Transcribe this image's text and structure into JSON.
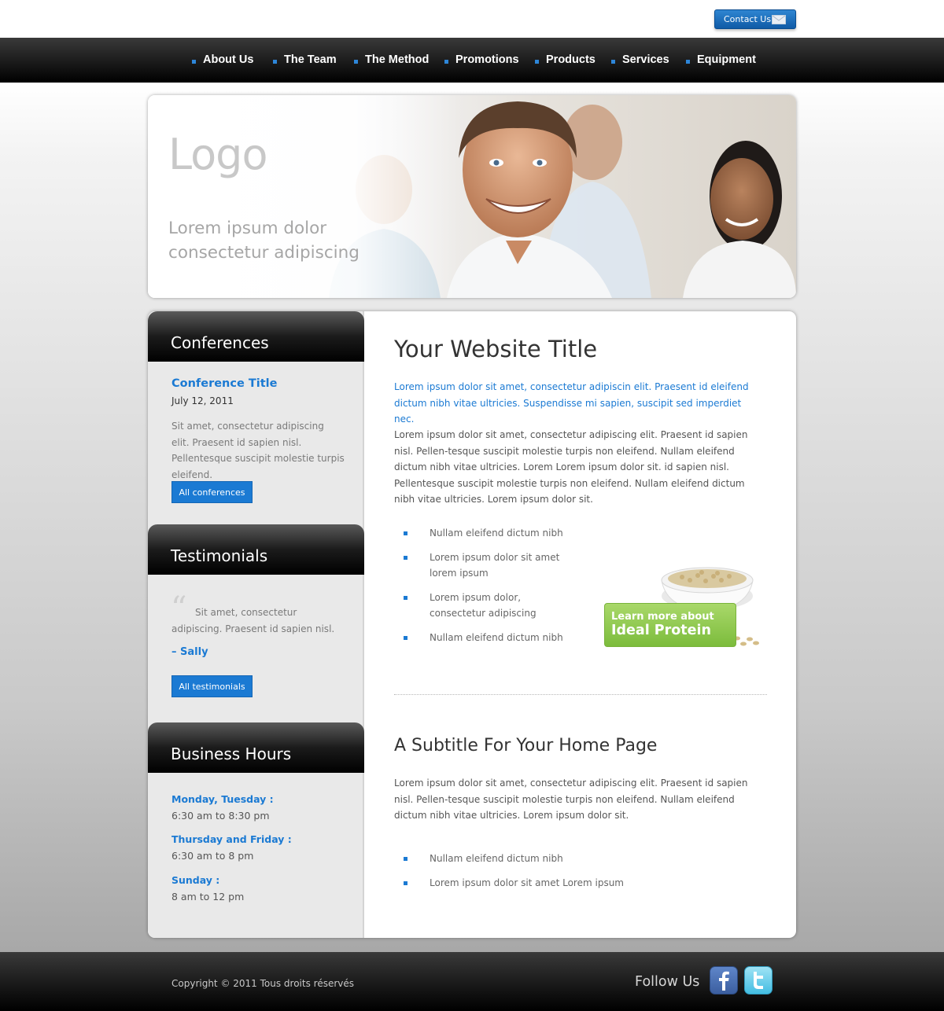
{
  "header": {
    "contact_label": "Contact Us"
  },
  "nav": {
    "items": [
      "About Us",
      "The Team",
      "The Method",
      "Promotions",
      "Products",
      "Services",
      "Equipment"
    ]
  },
  "hero": {
    "logo_text": "Logo",
    "tagline": "Lorem ipsum dolor consectetur adipiscing"
  },
  "sidebar": {
    "conferences": {
      "heading": "Conferences",
      "title": "Conference Title",
      "date": "July 12, 2011",
      "text": "Sit amet, consectetur adipiscing elit. Praesent id sapien nisl. Pellentesque suscipit molestie turpis eleifend.",
      "button": "All conferences"
    },
    "testimonials": {
      "heading": "Testimonials",
      "quote": "Sit amet, consectetur adipiscing. Praesent id sapien nisl.",
      "author": "– Sally",
      "button": "All testimonials"
    },
    "hours": {
      "heading": "Business Hours",
      "rows": [
        {
          "day": "Monday, Tuesday :",
          "time": "6:30 am to 8:30 pm"
        },
        {
          "day": "Thursday and Friday :",
          "time": "6:30 am to 8 pm"
        },
        {
          "day": "Sunday :",
          "time": "8 am to 12 pm"
        }
      ]
    }
  },
  "main": {
    "title": "Your Website Title",
    "intro": "Lorem ipsum dolor sit amet, consectetur adipiscin elit. Praesent id eleifend dictum nibh vitae ultricies. Suspendisse mi sapien, suscipit sed imperdiet nec.",
    "paragraph1": "Lorem ipsum dolor sit amet, consectetur adipiscing elit. Praesent id sapien nisl. Pellen-tesque suscipit molestie turpis non eleifend. Nullam eleifend dictum nibh vitae ultricies. Lorem Lorem ipsum dolor sit. id sapien nisl. Pellentesque suscipit molestie turpis non eleifend. Nullam eleifend dictum nibh vitae ultricies. Lorem ipsum dolor sit.",
    "list1": [
      "Nullam eleifend dictum nibh",
      "Lorem ipsum dolor sit amet lorem ipsum",
      "Lorem ipsum dolor, consectetur adipiscing",
      "Nullam eleifend dictum nibh"
    ],
    "promo": {
      "line1": "Learn more about",
      "line2": "Ideal Protein"
    },
    "subtitle": "A Subtitle For Your Home Page",
    "paragraph2": "Lorem ipsum dolor sit amet, consectetur adipiscing elit. Praesent id sapien nisl. Pellen-tesque suscipit molestie turpis non eleifend. Nullam eleifend dictum nibh vitae ultricies. Lorem ipsum dolor sit.",
    "list2": [
      "Nullam eleifend dictum nibh",
      "Lorem ipsum dolor sit amet Lorem ipsum"
    ]
  },
  "footer": {
    "copyright": "Copyright © 2011 Tous droits réservés",
    "follow_label": "Follow Us",
    "social": [
      "facebook-icon",
      "twitter-icon"
    ]
  },
  "colors": {
    "accent": "#1b7ad3",
    "nav_bullet": "#2d86d8",
    "promo_green": "#8cc84b"
  }
}
